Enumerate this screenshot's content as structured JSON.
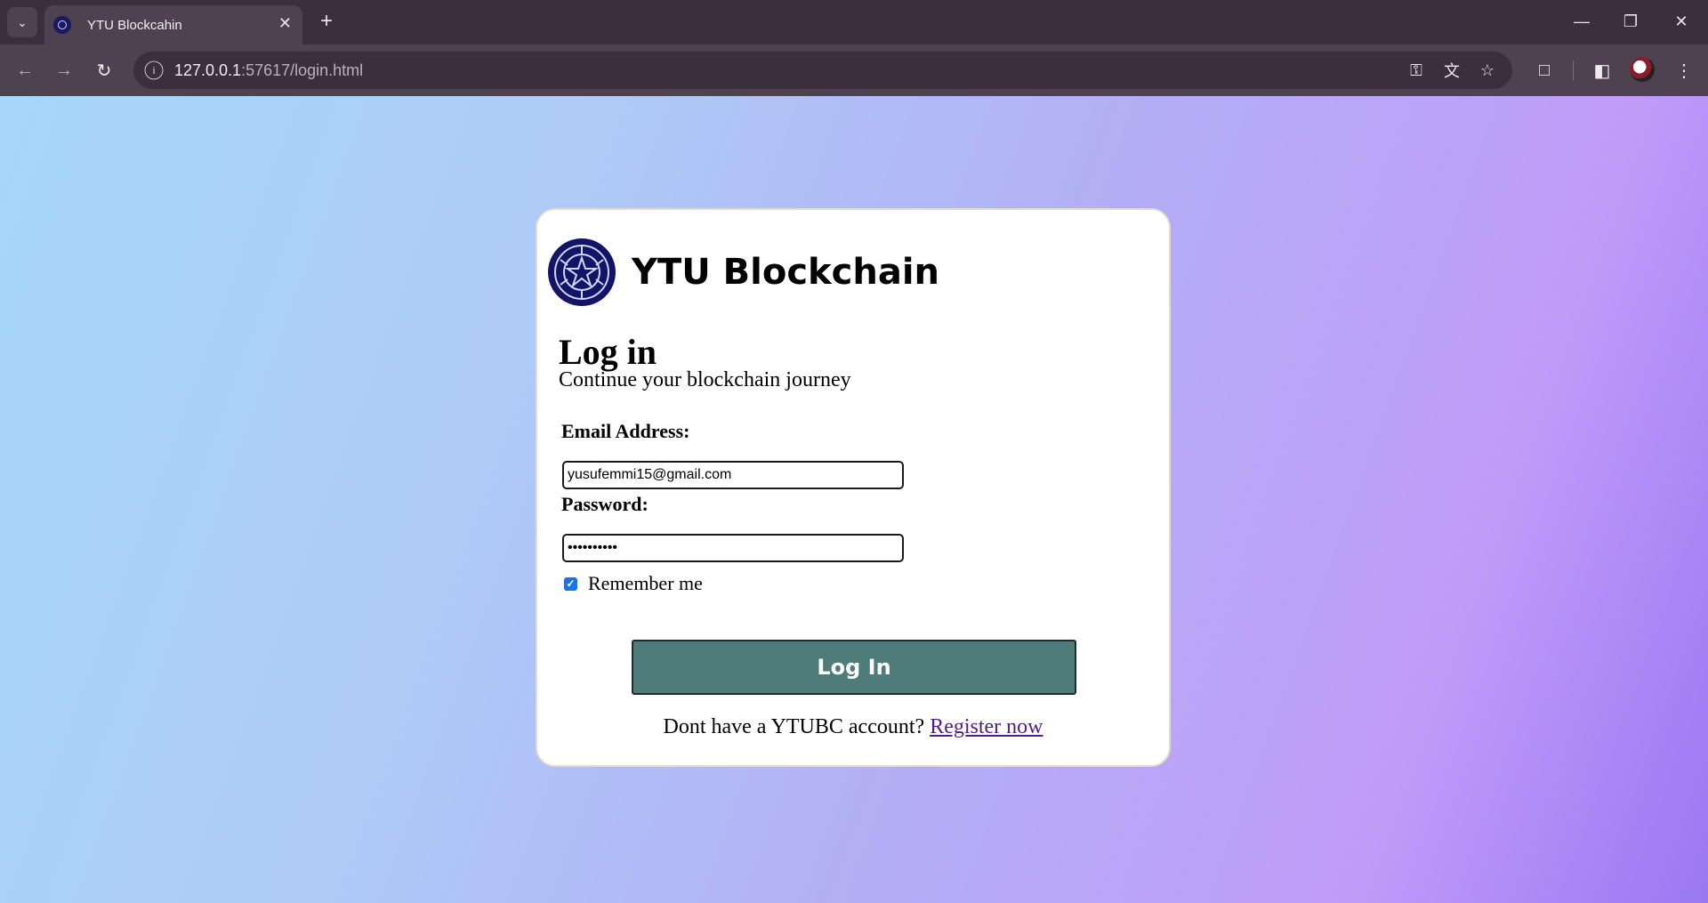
{
  "browser": {
    "tab_title": "YTU Blockcahin",
    "url_host": "127.0.0.1",
    "url_rest": ":57617/login.html"
  },
  "icons": {
    "tab_menu": "chevron-down-icon",
    "tab_close": "close-icon",
    "new_tab": "plus-icon",
    "back": "arrow-left-icon",
    "forward": "arrow-right-icon",
    "reload": "reload-icon",
    "site_info": "info-icon",
    "password": "key-icon",
    "translate": "translate-icon",
    "bookmark": "star-icon",
    "extensions": "puzzle-icon",
    "side_panel": "side-panel-icon",
    "menu": "kebab-menu-icon"
  },
  "card": {
    "brand_name": "YTU Blockchain",
    "heading": "Log in",
    "subheading": "Continue your blockchain journey",
    "email_label": "Email Address:",
    "email_value": "yusufemmi15@gmail.com",
    "password_label": "Password:",
    "password_value": "••••••••••",
    "remember_label": "Remember me",
    "remember_checked": true,
    "login_button": "Log In",
    "register_prompt": "Dont have a YTUBC account?",
    "register_link": "Register now"
  },
  "colors": {
    "button": "#4e7c7a",
    "link": "#551a8b",
    "logo": "#141466",
    "card_border": "#e8dcc8"
  }
}
